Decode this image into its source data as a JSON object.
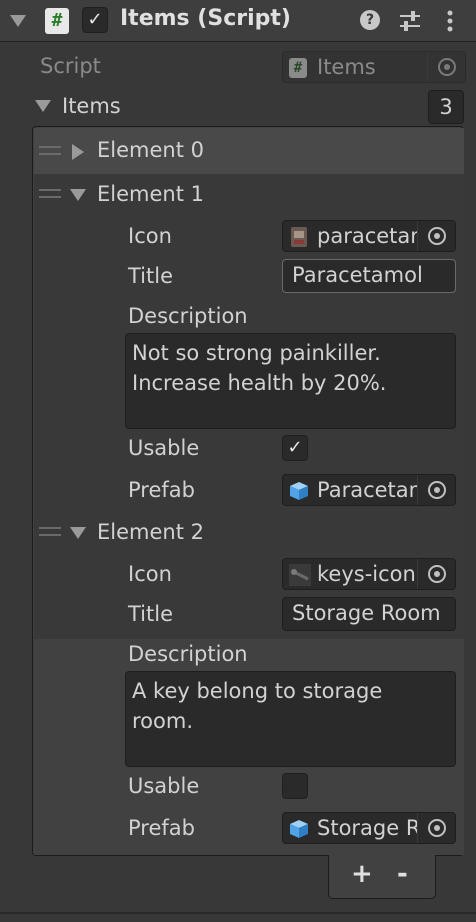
{
  "header": {
    "title": "Items (Script)",
    "enabled": true
  },
  "script_field": {
    "label": "Script",
    "value": "Items"
  },
  "items_list": {
    "label": "Items",
    "count": "3",
    "elements": [
      {
        "label": "Element 0"
      },
      {
        "label": "Element 1",
        "icon_label": "Icon",
        "icon_value": "paracetamol",
        "title_label": "Title",
        "title_value": "Paracetamol",
        "description_label": "Description",
        "description_value": "Not so strong painkiller. Increase health by 20%.",
        "usable_label": "Usable",
        "usable": true,
        "prefab_label": "Prefab",
        "prefab_value": "Paracetamol"
      },
      {
        "label": "Element 2",
        "icon_label": "Icon",
        "icon_value": "keys-icon",
        "title_label": "Title",
        "title_value": "Storage Room",
        "description_label": "Description",
        "description_value": "A key belong to storage room.",
        "usable_label": "Usable",
        "usable": false,
        "prefab_label": "Prefab",
        "prefab_value": "Storage Room"
      }
    ]
  },
  "footer": {
    "add": "+",
    "remove": "-"
  },
  "icons": {
    "foldout_arrow": "chevron-down-icon",
    "script": "csharp-script-icon",
    "help": "help-icon",
    "presets": "sliders-icon",
    "menu": "kebab-menu-icon",
    "picker": "object-picker-icon",
    "prefab": "prefab-cube-icon"
  },
  "colors": {
    "background": "#383838",
    "field": "#2a2a2a",
    "text": "#d2d2d2",
    "prefab_blue": "#4fa3e6"
  }
}
